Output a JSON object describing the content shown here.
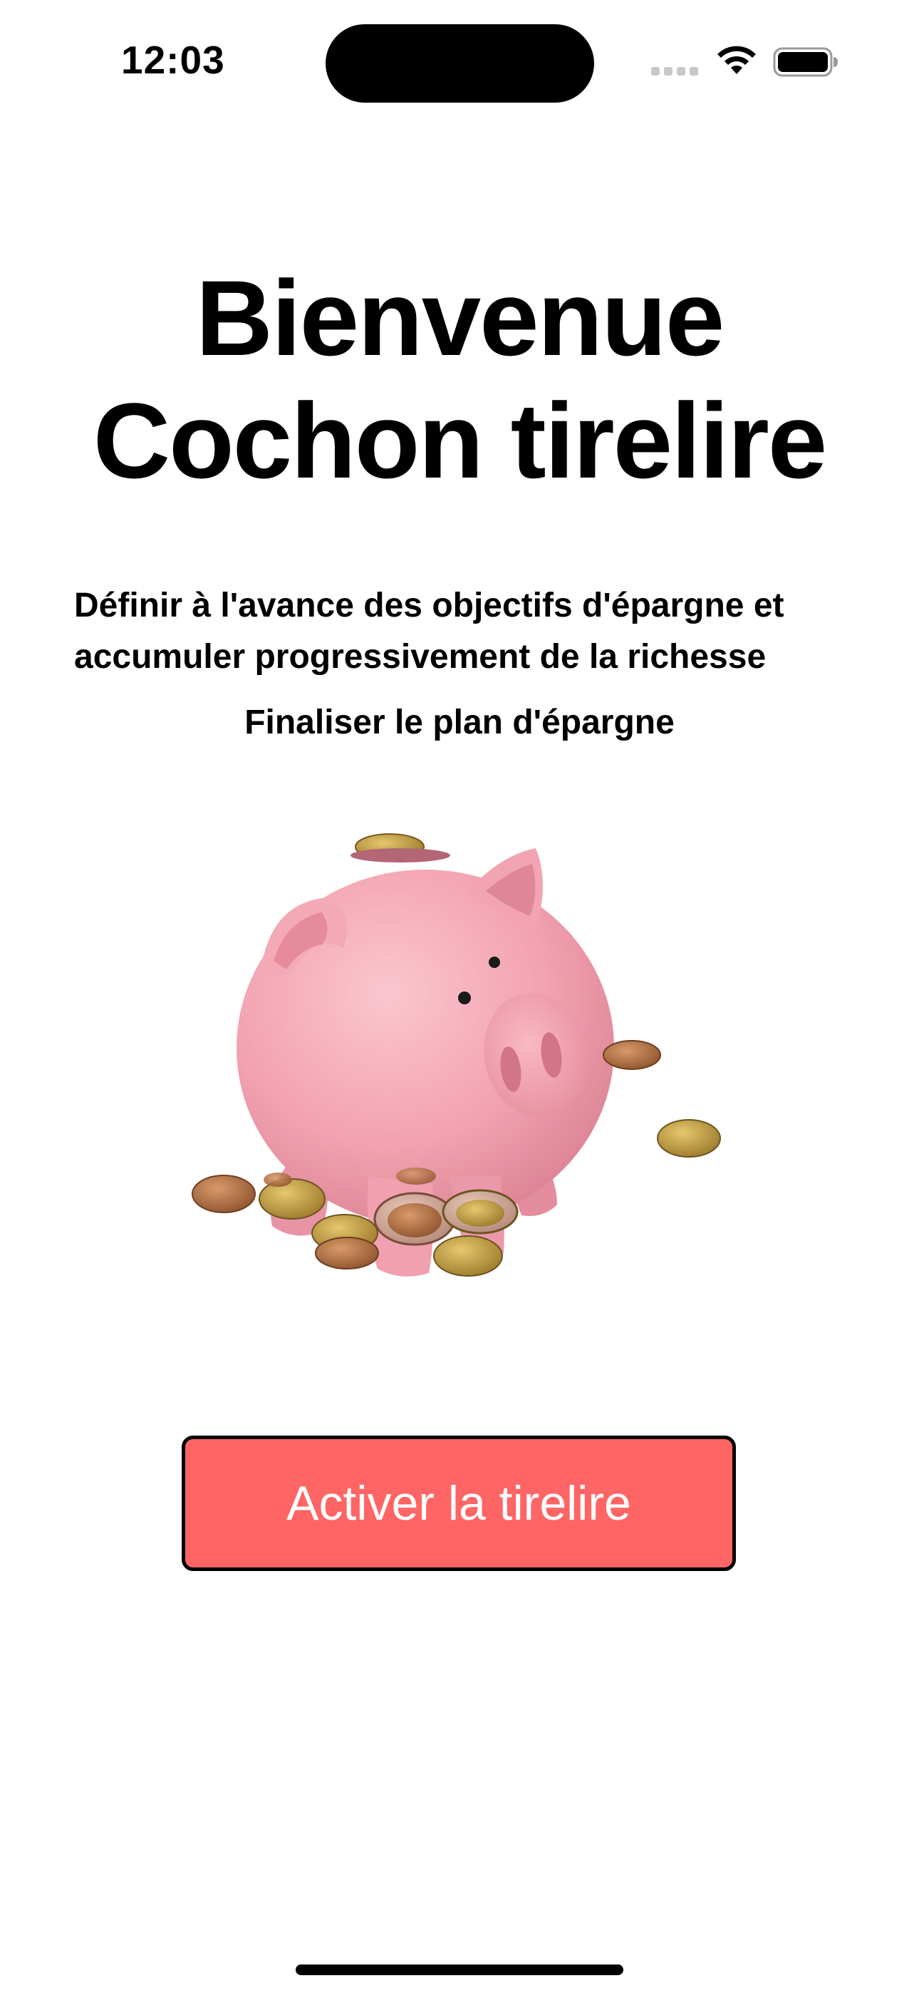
{
  "status_bar": {
    "time": "12:03",
    "icons": [
      "cellular-signal-icon",
      "wifi-icon",
      "battery-icon"
    ]
  },
  "welcome": {
    "title_line1": "Bienvenue",
    "title_line2": "Cochon tirelire",
    "description": "Définir à l'avance des objectifs d'épargne et accumuler progressivement de la richesse",
    "tagline": "Finaliser le plan d'épargne"
  },
  "illustration": {
    "icon": "piggy-bank-with-coins"
  },
  "actions": {
    "activate_label": "Activer la tirelire"
  },
  "colors": {
    "button_background": "#ff6565",
    "button_border": "#000000",
    "button_text": "#ffffff",
    "pig_pink": "#f4a7b3"
  }
}
